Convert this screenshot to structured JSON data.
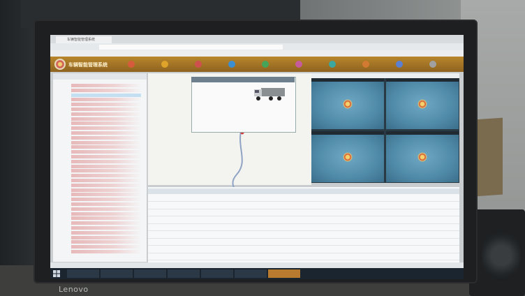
{
  "monitor": {
    "brand": "Lenovo"
  },
  "browser": {
    "tab_title": "车辆智能管理系统",
    "url": "",
    "bookmarks": [
      "",
      "",
      "",
      "",
      ""
    ]
  },
  "app": {
    "title": "车辆智能管理系统",
    "nav": [
      {
        "label": "",
        "color": "#d65b3c"
      },
      {
        "label": "",
        "color": "#e0a32a"
      },
      {
        "label": "",
        "color": "#cf4f4f"
      },
      {
        "label": "",
        "color": "#3b8fd1"
      },
      {
        "label": "",
        "color": "#46a35a"
      },
      {
        "label": "",
        "color": "#c55a9c"
      },
      {
        "label": "",
        "color": "#3aa7a0"
      },
      {
        "label": "",
        "color": "#d37a32"
      },
      {
        "label": "",
        "color": "#5b7fd1"
      },
      {
        "label": "",
        "color": "#a0a0a0"
      }
    ]
  },
  "popup": {
    "title": "",
    "rows": [
      "",
      "",
      "",
      "",
      "",
      ""
    ]
  },
  "cameras": [
    {
      "label": ""
    },
    {
      "label": ""
    },
    {
      "label": ""
    },
    {
      "label": ""
    }
  ],
  "table": {
    "headers": [
      "",
      "",
      "",
      "",
      "",
      "",
      "",
      "",
      "",
      ""
    ],
    "rows": [
      {
        "cells": [
          "",
          "",
          "",
          "",
          "",
          ""
        ]
      },
      {
        "cells": [
          "",
          "",
          "",
          "",
          "",
          ""
        ]
      },
      {
        "cells": [
          "",
          "",
          "",
          "",
          "",
          ""
        ]
      },
      {
        "cells": [
          "",
          "",
          "",
          "",
          "",
          ""
        ]
      },
      {
        "cells": [
          "",
          "",
          "",
          "",
          "",
          ""
        ]
      },
      {
        "cells": [
          "",
          "",
          "",
          "",
          "",
          ""
        ]
      },
      {
        "cells": [
          "",
          "",
          "",
          "",
          "",
          ""
        ]
      },
      {
        "cells": [
          "",
          "",
          "",
          "",
          "",
          ""
        ]
      },
      {
        "cells": [
          "",
          "",
          "",
          "",
          "",
          ""
        ]
      }
    ]
  },
  "statusbar": {
    "text": ""
  },
  "taskbar": {
    "items": [
      {
        "label": "",
        "active": false
      },
      {
        "label": "",
        "active": false
      },
      {
        "label": "",
        "active": false
      },
      {
        "label": "",
        "active": false
      },
      {
        "label": "",
        "active": false
      },
      {
        "label": "",
        "active": false
      },
      {
        "label": "",
        "active": true
      }
    ],
    "clock": ""
  },
  "colors": {
    "header": "#a87527",
    "tree_text": "#b33333",
    "camera_bg": "#5a94b2"
  }
}
